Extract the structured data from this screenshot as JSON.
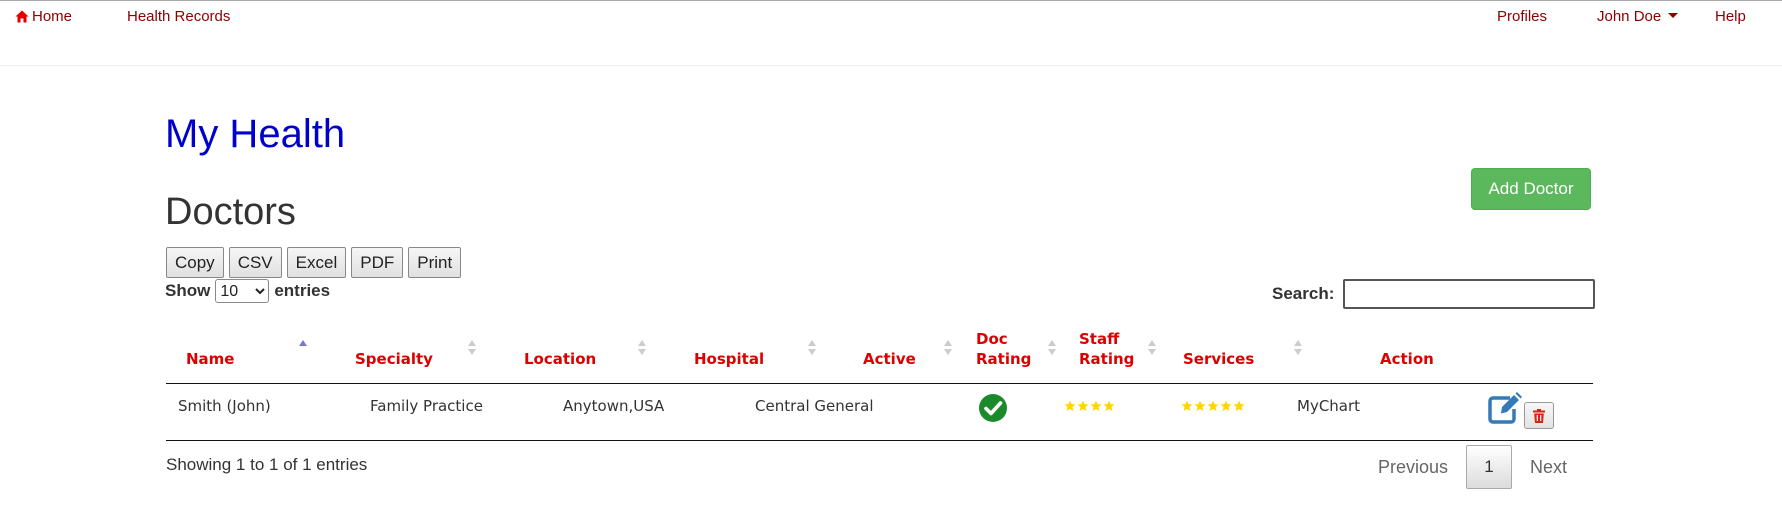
{
  "nav": {
    "home": "Home",
    "health_records": "Health Records",
    "profiles": "Profiles",
    "user": "John Doe",
    "help": "Help"
  },
  "page": {
    "app_title": "My Health",
    "section_title": "Doctors",
    "add_button": "Add Doctor"
  },
  "export_buttons": [
    "Copy",
    "CSV",
    "Excel",
    "PDF",
    "Print"
  ],
  "table_controls": {
    "show_label": "Show",
    "page_size": "10",
    "entries_label": "entries",
    "search_label": "Search:",
    "search_value": ""
  },
  "table": {
    "columns": [
      {
        "label": "Name",
        "sort": "asc"
      },
      {
        "label": "Specialty",
        "sort": "none"
      },
      {
        "label": "Location",
        "sort": "none"
      },
      {
        "label": "Hospital",
        "sort": "none"
      },
      {
        "label": "Active",
        "sort": "none"
      },
      {
        "label_line1": "Doc",
        "label_line2": "Rating",
        "sort": "none"
      },
      {
        "label_line1": "Staff",
        "label_line2": "Rating",
        "sort": "none"
      },
      {
        "label": "Services",
        "sort": "none"
      },
      {
        "label": "Action"
      }
    ],
    "rows": [
      {
        "name": "Smith (John)",
        "specialty": "Family Practice",
        "location": "Anytown,USA",
        "hospital": "Central General",
        "active": true,
        "doc_rating": 4,
        "staff_rating": 5,
        "services": "MyChart"
      }
    ]
  },
  "footer": {
    "info": "Showing 1 to 1 of 1 entries",
    "previous": "Previous",
    "page": "1",
    "next": "Next"
  },
  "colors": {
    "nav_text": "#8b0000",
    "app_title": "#0000cc",
    "header_text": "#dd0000",
    "add_button": "#5cb85c",
    "active_check": "#1a8a2a",
    "star": "#ffd700",
    "edit_icon": "#337ab7",
    "delete_icon": "#d9230f"
  },
  "icons": {
    "home": "home-icon",
    "user_menu": "caret-down-icon",
    "active": "check-circle-icon",
    "rating": "star-icon",
    "edit": "edit-icon",
    "delete": "trash-icon"
  }
}
